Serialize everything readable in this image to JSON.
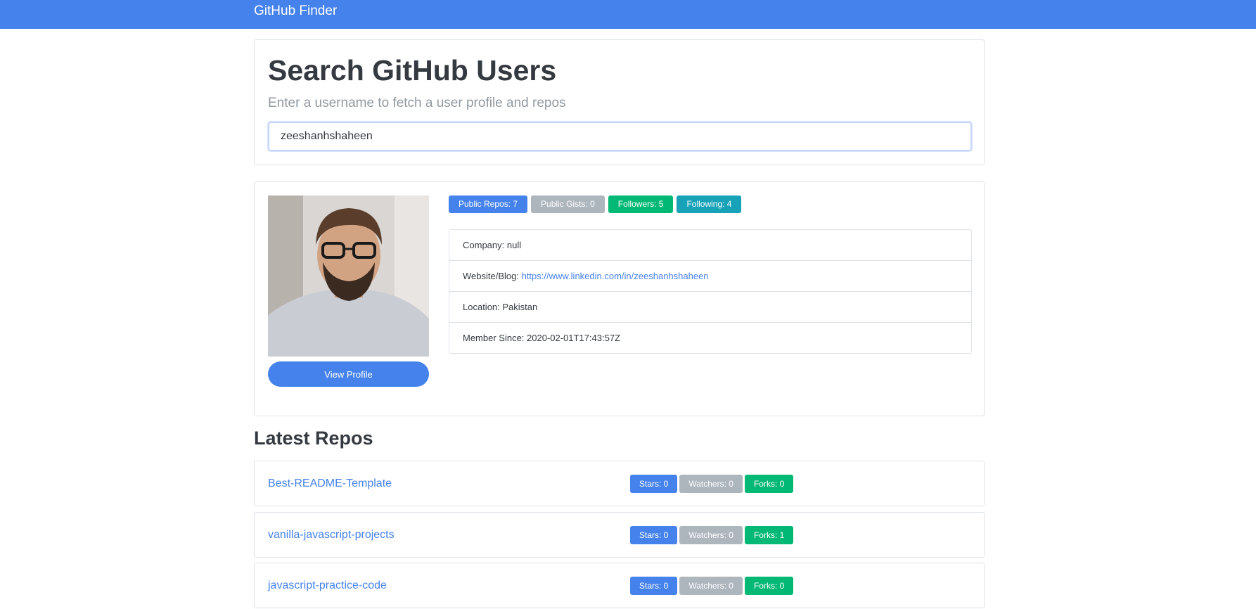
{
  "navbar": {
    "brand": "GitHub Finder"
  },
  "search": {
    "title": "Search GitHub Users",
    "subtitle": "Enter a username to fetch a user profile and repos",
    "value": "zeeshanhshaheen"
  },
  "profile": {
    "avatar_alt": "avatar",
    "view_profile_label": "View Profile",
    "badges": {
      "public_repos": "Public Repos: 7",
      "public_gists": "Public Gists: 0",
      "followers": "Followers: 5",
      "following": "Following: 4"
    },
    "company": "Company: null",
    "website_label": "Website/Blog: ",
    "website_url": "https://www.linkedin.com/in/zeeshanhshaheen",
    "location": "Location: Pakistan",
    "member_since": "Member Since: 2020-02-01T17:43:57Z"
  },
  "repos": {
    "heading": "Latest Repos",
    "items": [
      {
        "name": "Best-README-Template",
        "stars": "Stars: 0",
        "watchers": "Watchers: 0",
        "forks": "Forks: 0"
      },
      {
        "name": "vanilla-javascript-projects",
        "stars": "Stars: 0",
        "watchers": "Watchers: 0",
        "forks": "Forks: 1"
      },
      {
        "name": "javascript-practice-code",
        "stars": "Stars: 0",
        "watchers": "Watchers: 0",
        "forks": "Forks: 0"
      }
    ]
  },
  "colors": {
    "primary": "#4582ec",
    "secondary": "#adb5bd",
    "success": "#02b875",
    "info": "#17a2b8"
  }
}
